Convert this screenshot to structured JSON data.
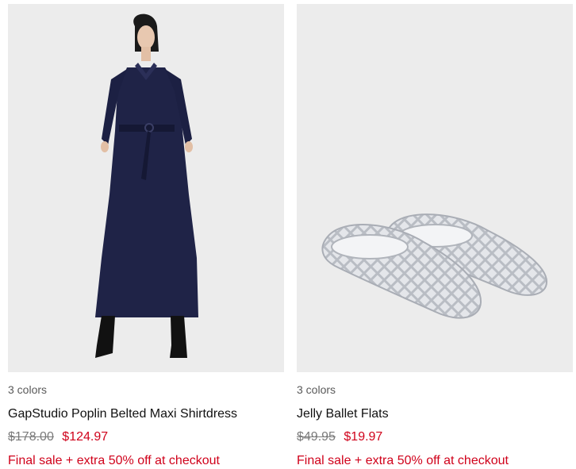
{
  "colors": {
    "sale": "#d0021b",
    "image_bg": "#ececec"
  },
  "products": [
    {
      "image_alt": "",
      "colors_label": "3 colors",
      "name": "GapStudio Poplin Belted Maxi Shirtdress",
      "original_price": "$178.00",
      "sale_price": "$124.97",
      "promo": "Final sale + extra 50% off at checkout"
    },
    {
      "image_alt": "",
      "colors_label": "3 colors",
      "name": "Jelly Ballet Flats",
      "original_price": "$49.95",
      "sale_price": "$19.97",
      "promo": "Final sale + extra 50% off at checkout"
    }
  ]
}
